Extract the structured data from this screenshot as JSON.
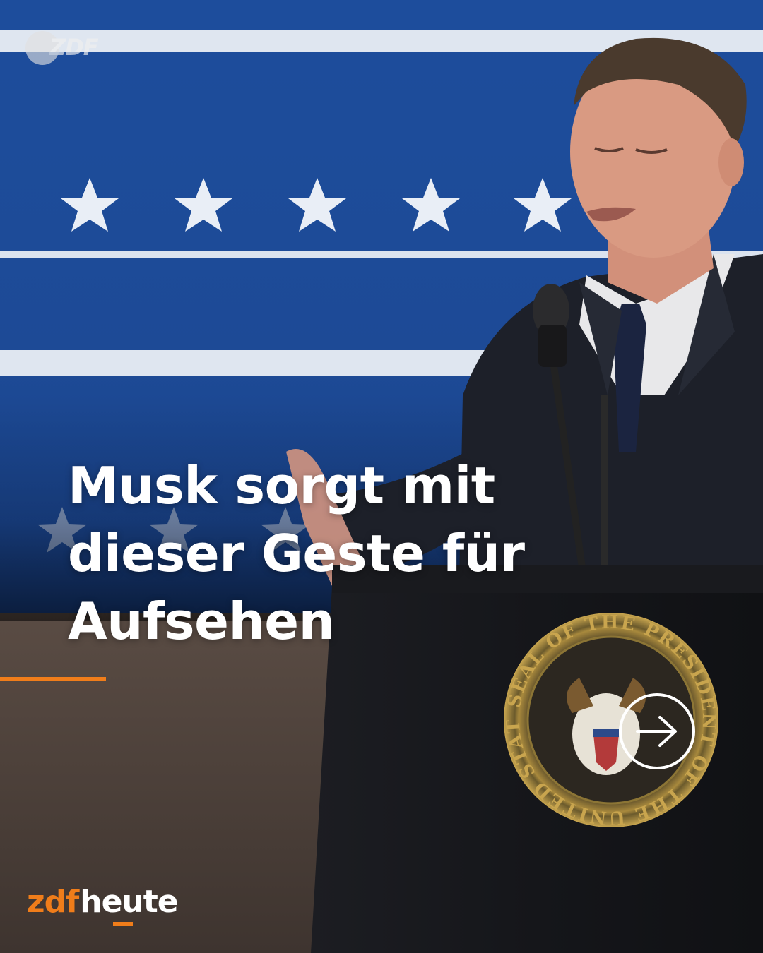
{
  "post": {
    "headline_lines": [
      "Musk sorgt mit",
      "dieser Geste für",
      "Aufsehen"
    ],
    "channel_bug": "ZDF",
    "brand": {
      "part1": "zdf",
      "part2": "heute"
    },
    "next_icon": "arrow-right-circle-icon",
    "seal_text": "SEAL OF THE PRESIDENT OF THE UNITED STATES",
    "colors": {
      "accent": "#f07d1a",
      "backdrop_blue": "#1e4f9e",
      "text": "#ffffff"
    }
  }
}
